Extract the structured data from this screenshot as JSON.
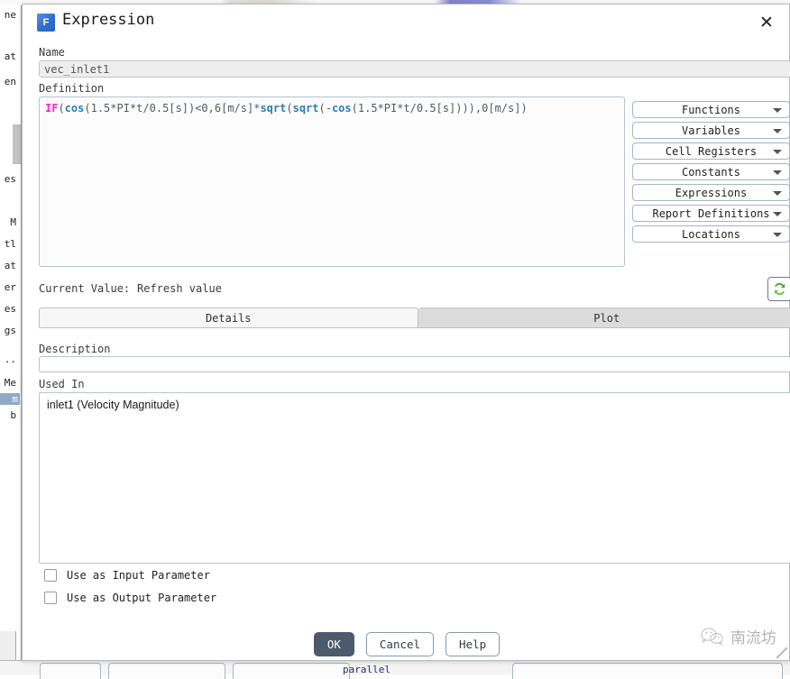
{
  "dialog": {
    "title": "Expression",
    "app_icon_letter": "F",
    "close_icon": "close-icon"
  },
  "name_field": {
    "label": "Name",
    "value": "vec_inlet1",
    "placeholder": ""
  },
  "definition": {
    "label": "Definition",
    "tokens": [
      {
        "text": "IF",
        "kind": "kw"
      },
      {
        "text": "(",
        "kind": "plain"
      },
      {
        "text": "cos",
        "kind": "fn"
      },
      {
        "text": "(1.5*PI*t/0.5[s])<0,6[m/s]*",
        "kind": "plain"
      },
      {
        "text": "sqrt",
        "kind": "fn"
      },
      {
        "text": "(",
        "kind": "plain"
      },
      {
        "text": "sqrt",
        "kind": "fn"
      },
      {
        "text": "(-",
        "kind": "plain"
      },
      {
        "text": "cos",
        "kind": "fn"
      },
      {
        "text": "(1.5*PI*t/0.5[s]))),0[m/s])",
        "kind": "plain"
      }
    ],
    "plain_text": "IF(cos(1.5*PI*t/0.5[s])<0,6[m/s]*sqrt(sqrt(-cos(1.5*PI*t/0.5[s]))),0[m/s])",
    "colors": {
      "keyword": "#ff22cc",
      "function": "#2f7fb5",
      "plain": "#555a60"
    }
  },
  "dropdowns": [
    {
      "label": "Functions"
    },
    {
      "label": "Variables"
    },
    {
      "label": "Cell Registers"
    },
    {
      "label": "Constants"
    },
    {
      "label": "Expressions"
    },
    {
      "label": "Report Definitions"
    },
    {
      "label": "Locations"
    }
  ],
  "current_value": {
    "label": "Current Value:",
    "refresh_label": "Refresh value",
    "refresh_icon": "refresh-icon"
  },
  "tabs": [
    {
      "label": "Details",
      "active": true
    },
    {
      "label": "Plot",
      "active": false
    }
  ],
  "description": {
    "label": "Description",
    "value": "",
    "placeholder": ""
  },
  "used_in": {
    "label": "Used In",
    "items": [
      "inlet1 (Velocity Magnitude)"
    ]
  },
  "checkboxes": [
    {
      "label": "Use as Input Parameter",
      "checked": false
    },
    {
      "label": "Use as Output Parameter",
      "checked": false
    }
  ],
  "footer": {
    "ok_label": "OK",
    "cancel_label": "Cancel",
    "help_label": "Help"
  },
  "watermark": {
    "text": "南流坊",
    "icon": "wechat-icon"
  },
  "background": {
    "tree_items": [
      "ne",
      "at",
      "en",
      "es",
      "M",
      "tl",
      "at",
      "er",
      "es",
      "gs",
      "..",
      "Me",
      "m",
      "b"
    ],
    "selected_tree_index": 12,
    "status_text": "parallel"
  }
}
